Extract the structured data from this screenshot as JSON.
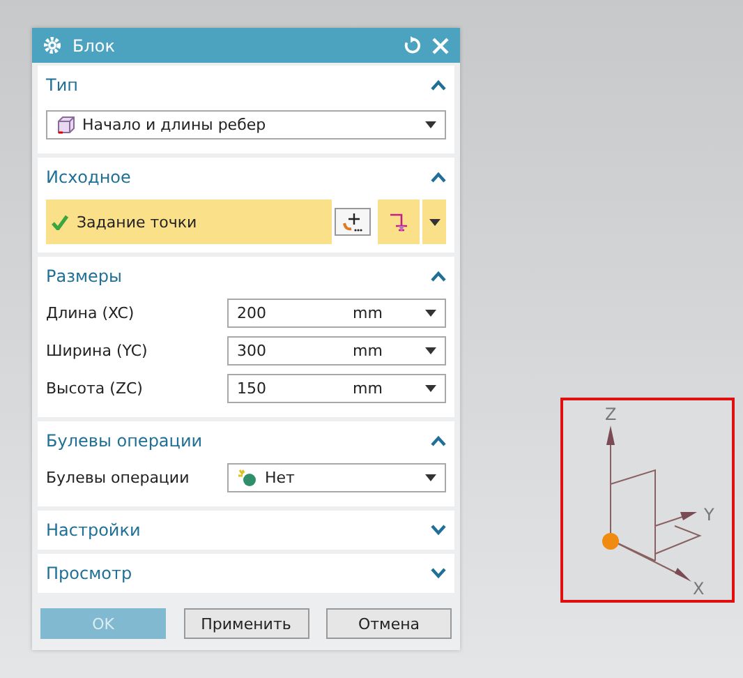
{
  "dialog": {
    "title": "Блок",
    "sections": [
      {
        "kind": "type",
        "title": "Тип",
        "expanded": true,
        "dropdown": "Начало и длины ребер"
      },
      {
        "kind": "origin",
        "title": "Исходное",
        "expanded": true,
        "selector": "Задание точки"
      },
      {
        "kind": "dims",
        "title": "Размеры",
        "expanded": true,
        "rows": [
          {
            "label": "Длина (XC)",
            "value": "200",
            "unit": "mm"
          },
          {
            "label": "Ширина (YC)",
            "value": "300",
            "unit": "mm"
          },
          {
            "label": "Высота (ZC)",
            "value": "150",
            "unit": "mm"
          }
        ]
      },
      {
        "kind": "boolean",
        "title": "Булевы операции",
        "expanded": true,
        "label": "Булевы операции",
        "value": "Нет"
      },
      {
        "title": "Настройки",
        "expanded": false
      },
      {
        "title": "Просмотр",
        "expanded": false
      }
    ],
    "buttons": [
      {
        "label": "OK",
        "disabled": true
      },
      {
        "label": "Применить",
        "disabled": false
      },
      {
        "label": "Отмена",
        "disabled": false
      }
    ]
  },
  "viewport": {
    "axis_labels": {
      "z": "Z",
      "y": "Y",
      "x": "X"
    }
  }
}
